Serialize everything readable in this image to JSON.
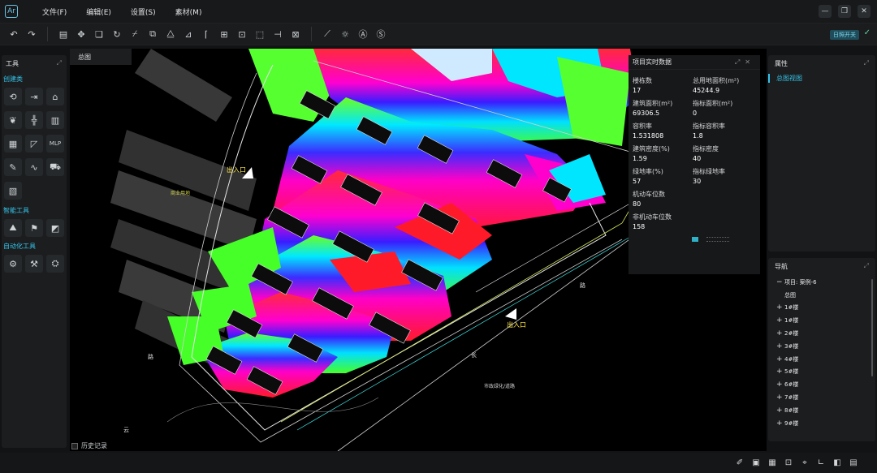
{
  "app": {
    "logo_glyph": "Ar"
  },
  "menu": [
    "文件(F)",
    "编辑(E)",
    "设置(S)",
    "素材(M)"
  ],
  "window_controls": [
    "—",
    "❐",
    "✕"
  ],
  "toolbar": {
    "sun_toggle_label": "日照开关",
    "icons": [
      "undo-icon",
      "redo-icon",
      "building-icon",
      "move-icon",
      "copy-icon",
      "rotate-icon",
      "trim-icon",
      "offset-icon",
      "mirror-icon",
      "align-icon",
      "extend-icon",
      "array-icon",
      "group-icon",
      "stretch-icon",
      "break-icon",
      "scale-icon",
      "measure-icon",
      "sunshine-icon",
      "text-style-icon",
      "stamp-icon"
    ]
  },
  "left_panel": {
    "title": "工具",
    "sections": [
      {
        "title": "创建类",
        "tools": [
          "road-tool-icon",
          "entry-tool-icon",
          "building-add-icon",
          "tree-icon",
          "axis-icon",
          "block-icon",
          "grid-icon",
          "triangle-icon",
          "mlp-icon",
          "pen-icon",
          "curve-icon",
          "car-icon",
          "document-icon"
        ]
      },
      {
        "title": "智能工具",
        "tools": [
          "layout-ai-icon",
          "site-ai-icon",
          "chart-ai-icon"
        ]
      },
      {
        "title": "自动化工具",
        "tools": [
          "auto-1-icon",
          "auto-2-icon",
          "auto-3-icon"
        ]
      }
    ]
  },
  "history_label": "历史记录",
  "canvas": {
    "tab": "总图",
    "labels": {
      "entry_top": "出入口",
      "entry_bottom": "出入口",
      "road_a": "路",
      "road_b": "路",
      "road_c": "云",
      "road_d": "长",
      "municipal": "市政绿化/道路",
      "area_left": "商业用地"
    }
  },
  "realtime": {
    "title": "项目实时数据",
    "stats": [
      {
        "k": "楼栋数",
        "v": "17"
      },
      {
        "k": "总用地面积(m²)",
        "v": "45244.9"
      },
      {
        "k": "建筑面积(m²)",
        "v": "69306.5"
      },
      {
        "k": "指标面积(m²)",
        "v": "0"
      },
      {
        "k": "容积率",
        "v": "1.531808"
      },
      {
        "k": "指标容积率",
        "v": "1.8"
      },
      {
        "k": "建筑密度(%)",
        "v": "1.59"
      },
      {
        "k": "指标密度",
        "v": "40"
      },
      {
        "k": "绿地率(%)",
        "v": "57"
      },
      {
        "k": "指标绿地率",
        "v": "30"
      },
      {
        "k": "机动车位数",
        "v": "80"
      },
      {
        "k": "",
        "v": ""
      },
      {
        "k": "非机动车位数",
        "v": "158"
      }
    ]
  },
  "properties": {
    "title": "属性",
    "item": "总图视图"
  },
  "navigation": {
    "title": "导航",
    "root": "项目: 案例-6",
    "overview": "总图",
    "buildings": [
      "1#楼",
      "1#楼",
      "2#楼",
      "3#楼",
      "4#楼",
      "5#楼",
      "6#楼",
      "7#楼",
      "8#楼",
      "9#楼"
    ]
  },
  "statusbar_icons": [
    "pen-status-icon",
    "layer-status-icon",
    "grid-status-icon",
    "snap-status-icon",
    "ortho-status-icon",
    "angle-status-icon",
    "panel-status-icon",
    "table-status-icon"
  ]
}
